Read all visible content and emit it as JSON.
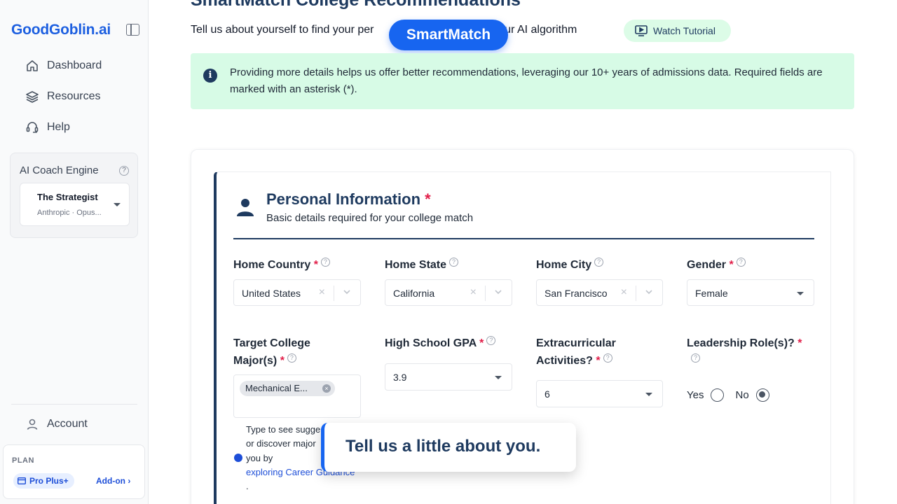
{
  "sidebar": {
    "logo": "GoodGoblin.ai",
    "nav": [
      {
        "label": "Dashboard",
        "icon": "home-icon"
      },
      {
        "label": "Resources",
        "icon": "layers-icon"
      },
      {
        "label": "Help",
        "icon": "headset-icon"
      }
    ],
    "coach": {
      "title": "AI Coach Engine",
      "selected_name": "The Strategist",
      "selected_model": "Anthropic · Opus..."
    },
    "account_label": "Account",
    "plan": {
      "label": "PLAN",
      "badge": "Pro Plus+",
      "addon": "Add-on ›"
    }
  },
  "header": {
    "title": "SmartMatch College Recommendations",
    "subtitle_start": "Tell us about yourself to find your per",
    "subtitle_end": "ing our AI algorithm",
    "smartmatch_pill": "SmartMatch",
    "tutorial_button": "Watch Tutorial"
  },
  "info": {
    "icon": "info-icon",
    "text": "Providing more details helps us offer better recommendations, leveraging our 10+ years of admissions data. Required fields are marked with an asterisk (*)."
  },
  "section": {
    "title": "Personal Information",
    "required_mark": "*",
    "subtitle": "Basic details required for your college match"
  },
  "fields": {
    "home_country": {
      "label": "Home Country",
      "required": "*",
      "value": "United States"
    },
    "home_state": {
      "label": "Home State",
      "value": "California"
    },
    "home_city": {
      "label": "Home City",
      "value": "San Francisco"
    },
    "gender": {
      "label": "Gender",
      "required": "*",
      "value": "Female"
    },
    "major": {
      "label_line1": "Target College",
      "label_line2": "Major(s)",
      "required": "*",
      "chip": "Mechanical E..."
    },
    "gpa": {
      "label": "High School GPA",
      "required": "*",
      "value": "3.9"
    },
    "extracurricular": {
      "label_line1": "Extracurricular",
      "label_line2": "Activities?",
      "required": "*",
      "value": "6"
    },
    "leadership": {
      "label": "Leadership Role(s)?",
      "required": "*",
      "yes": "Yes",
      "no": "No",
      "selected": "No"
    }
  },
  "major_hint": {
    "line1": "Type to see sugge",
    "line2": "or discover major",
    "line3": "you by",
    "link": "exploring Career Guidance",
    "tail": "."
  },
  "tooltip": {
    "text": "Tell us a little about you."
  },
  "help_glyph": "?",
  "clear_glyph": "×"
}
